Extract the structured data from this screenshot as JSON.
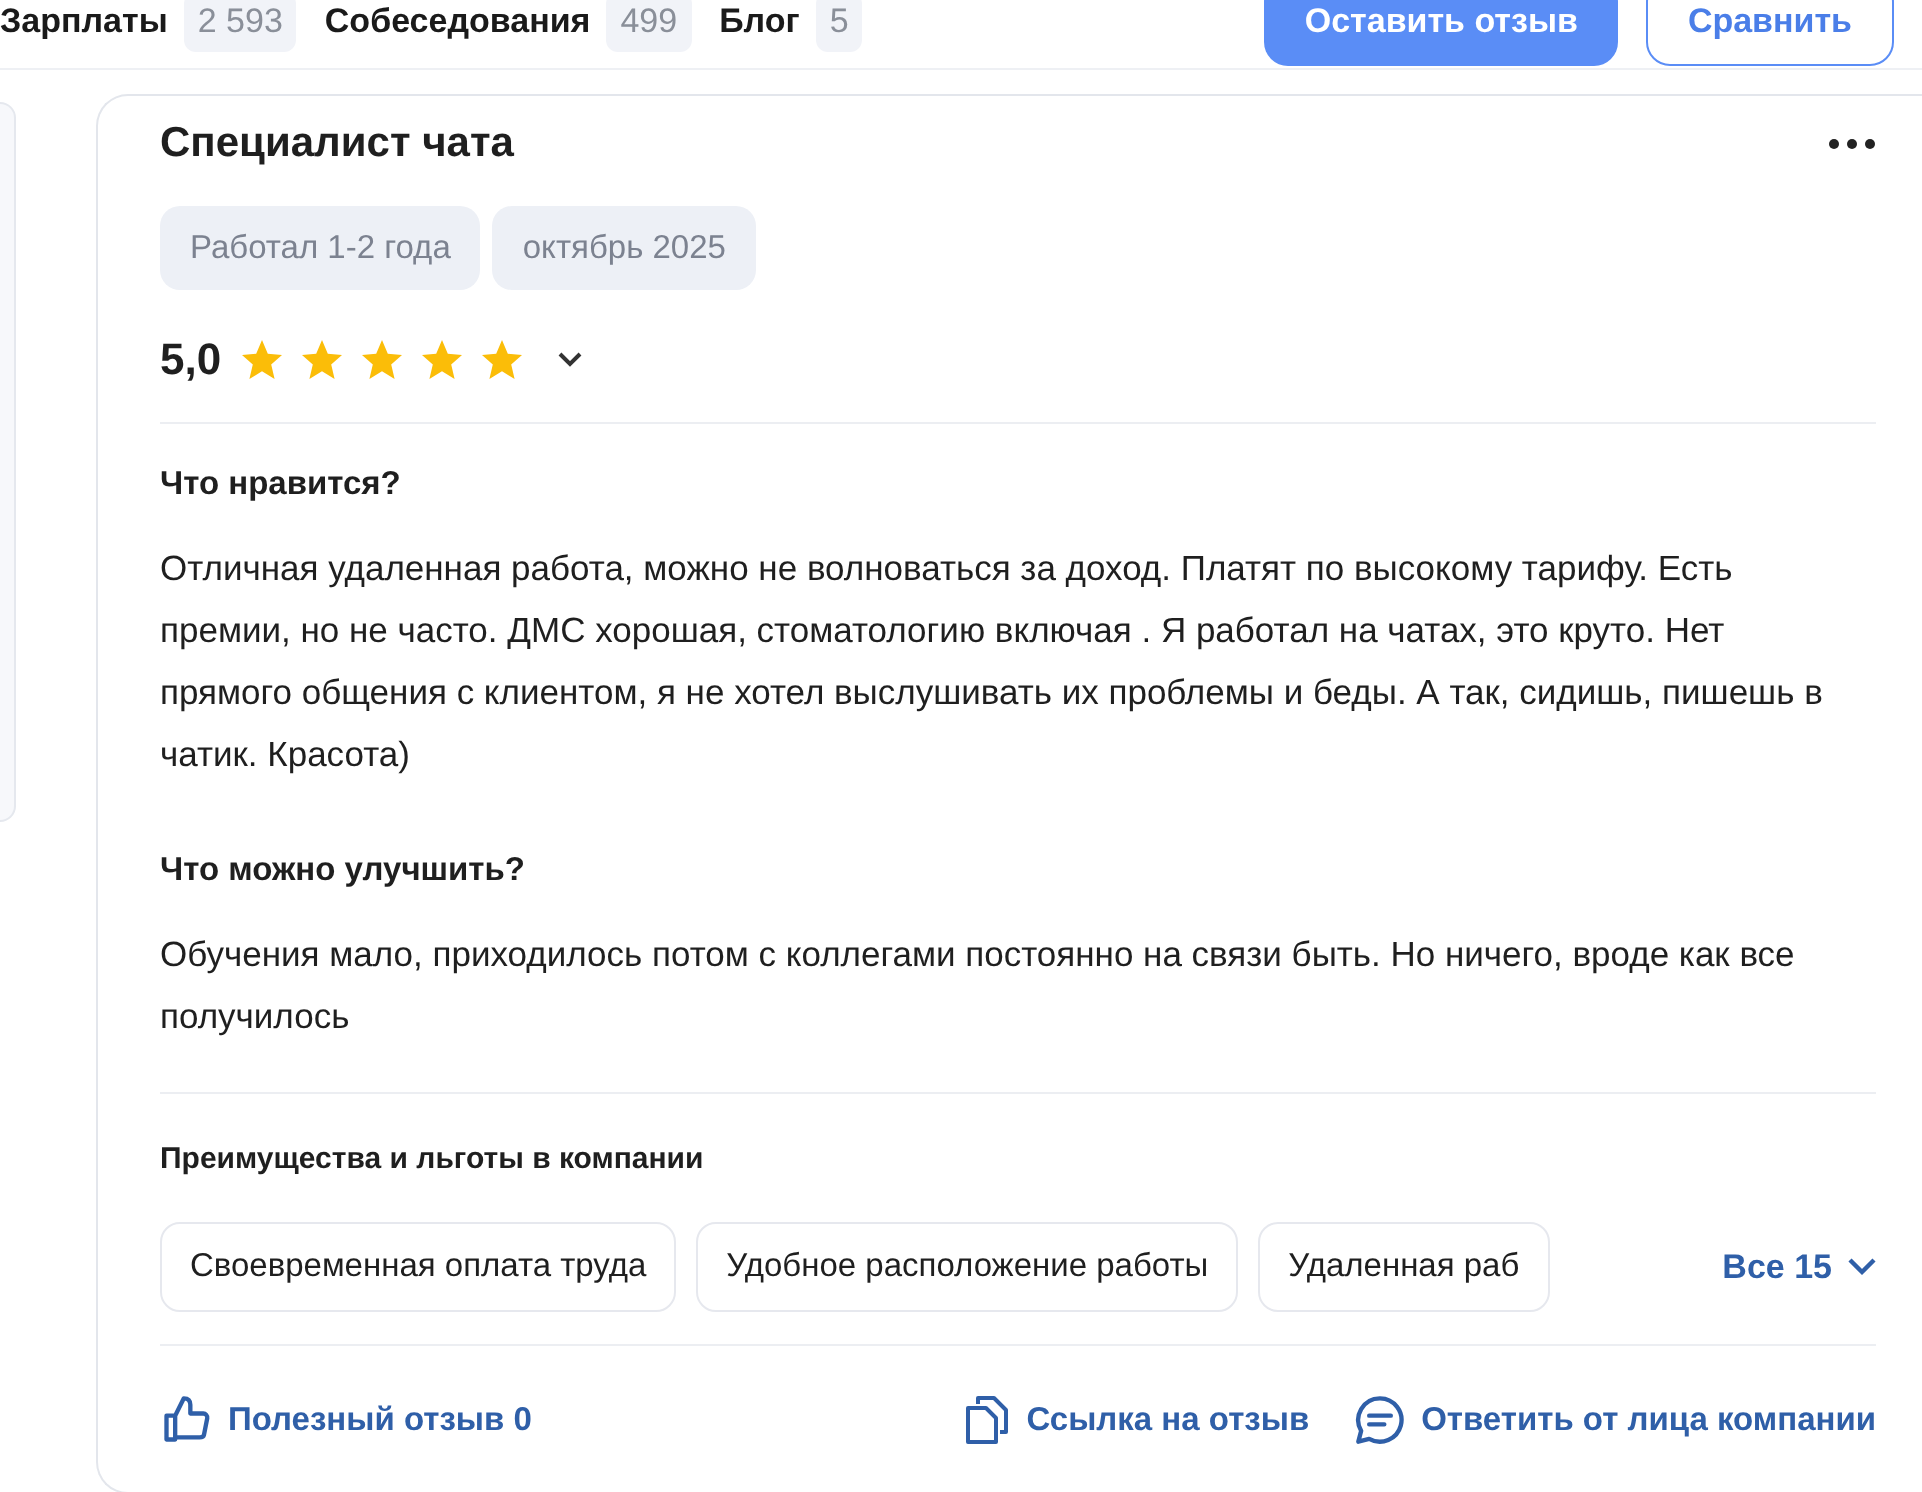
{
  "nav": [
    {
      "label": "Зарплаты",
      "count": "2 593"
    },
    {
      "label": "Собеседования",
      "count": "499"
    },
    {
      "label": "Блог",
      "count": "5"
    }
  ],
  "actions": {
    "primary": "Оставить отзыв",
    "secondary": "Сравнить"
  },
  "review": {
    "title": "Специалист чата",
    "tags": [
      "Работал 1-2 года",
      "октябрь 2025"
    ],
    "rating": "5,0",
    "stars": 5,
    "sections": [
      {
        "heading": "Что нравится?",
        "text": "Отличная удаленная работа, можно не волноваться за доход. Платят по высокому тарифу. Есть премии, но не часто. ДМС хорошая, стоматологию включая . Я работал на чатах, это круто. Нет прямого общения с клиентом, я не хотел выслушивать их проблемы и беды. А так, сидишь, пишешь в чатик. Красота)"
      },
      {
        "heading": "Что можно улучшить?",
        "text": "Обучения мало, приходилось потом с коллегами постоянно на связи быть. Но ничего, вроде как все получилось"
      }
    ],
    "benefits": {
      "heading": "Преимущества и льготы в компании",
      "items": [
        "Своевременная оплата труда",
        "Удобное расположение работы",
        "Удаленная раб"
      ],
      "more": "Все 15"
    },
    "footer": {
      "useful": "Полезный отзыв 0",
      "link": "Ссылка на отзыв",
      "reply": "Ответить от лица компании"
    }
  }
}
